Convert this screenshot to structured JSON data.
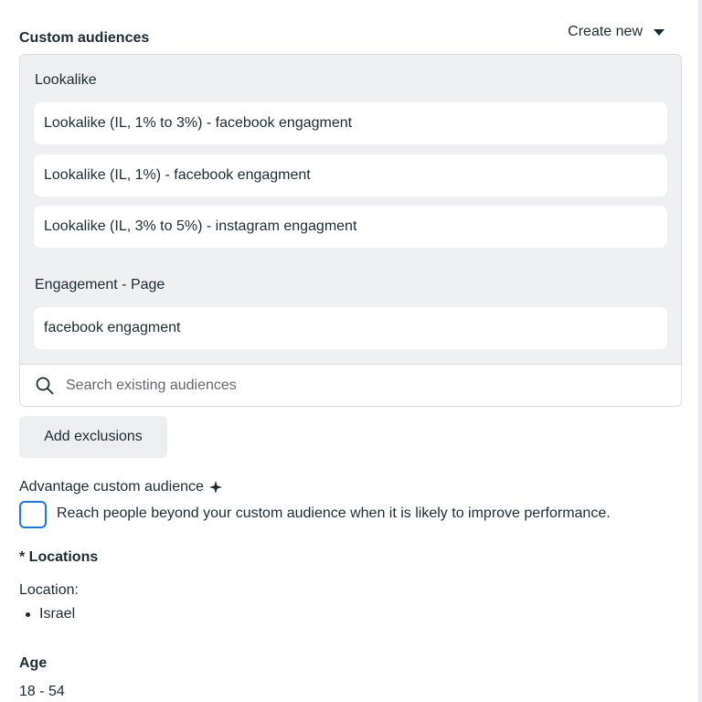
{
  "custom_audiences": {
    "title": "Custom audiences",
    "create_new_label": "Create new",
    "groups": [
      {
        "label": "Lookalike",
        "items": [
          "Lookalike (IL, 1% to 3%) - facebook engagment",
          "Lookalike (IL, 1%) - facebook engagment",
          "Lookalike (IL, 3% to 5%) - instagram engagment"
        ]
      },
      {
        "label": "Engagement - Page",
        "items": [
          "facebook engagment"
        ]
      }
    ],
    "search": {
      "placeholder": "Search existing audiences",
      "value": ""
    }
  },
  "add_exclusions_label": "Add exclusions",
  "advantage": {
    "title": "Advantage custom audience",
    "sparkle_symbol": "✦",
    "checkbox_checked": false,
    "description": "Reach people beyond your custom audience when it is likely to improve performance."
  },
  "locations": {
    "title": "* Locations",
    "label": "Location:",
    "items": [
      "Israel"
    ]
  },
  "age": {
    "title": "Age",
    "value": "18 - 54"
  },
  "icons": {
    "create_new_caret": "caret-down-icon",
    "search": "search-icon",
    "advantage": "sparkle-icon"
  },
  "colors": {
    "accent": "#1877f2",
    "list_background": "#eff0f2",
    "button_background": "#eceef0",
    "text": "#1c2b33"
  }
}
